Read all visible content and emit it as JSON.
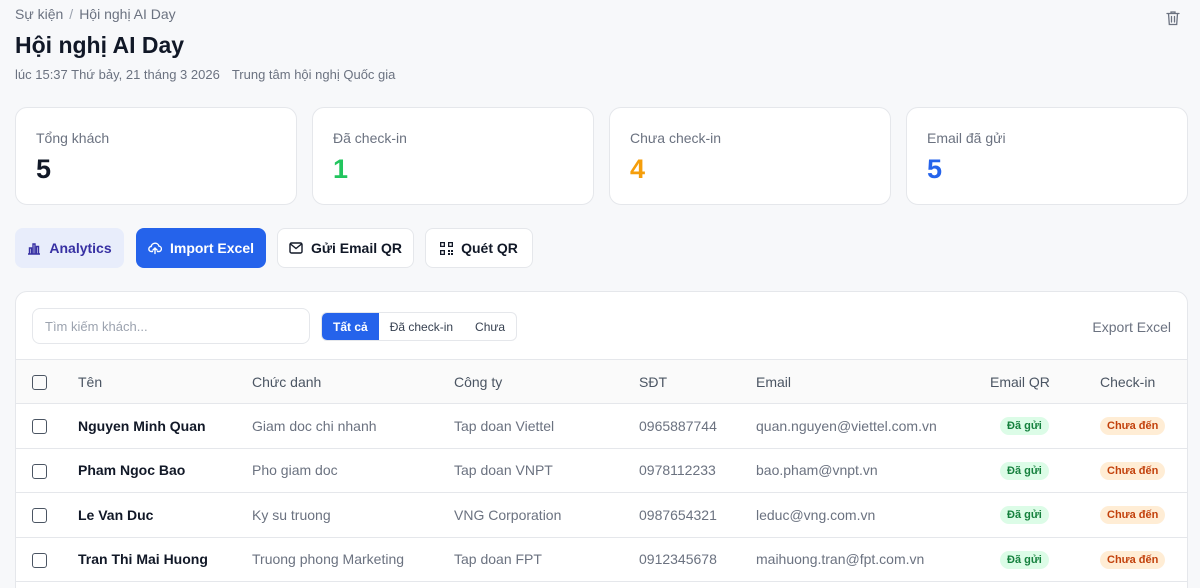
{
  "breadcrumb": {
    "parent": "Sự kiện",
    "separator": "/",
    "current": "Hội nghị AI Day"
  },
  "event": {
    "title": "Hội nghị AI Day",
    "datetime": "lúc 15:37 Thứ bảy, 21 tháng 3 2026",
    "venue": "Trung tâm hội nghị Quốc gia"
  },
  "stats": [
    {
      "label": "Tổng khách",
      "value": "5",
      "color": "#111827"
    },
    {
      "label": "Đã check-in",
      "value": "1",
      "color": "#22c55e"
    },
    {
      "label": "Chưa check-in",
      "value": "4",
      "color": "#f59e0b"
    },
    {
      "label": "Email đã gửi",
      "value": "5",
      "color": "#2563eb"
    }
  ],
  "actions": {
    "analytics": "Analytics",
    "import": "Import Excel",
    "email": "Gửi Email QR",
    "scan": "Quét QR"
  },
  "guests": {
    "search_placeholder": "Tìm kiếm khách...",
    "filters": [
      "Tất cả",
      "Đã check-in",
      "Chưa"
    ],
    "active_filter": 0,
    "export_label": "Export Excel",
    "columns": [
      "Tên",
      "Chức danh",
      "Công ty",
      "SĐT",
      "Email",
      "Email QR",
      "Check-in"
    ],
    "rows": [
      {
        "name": "Nguyen Minh Quan",
        "title": "Giam doc chi nhanh",
        "company": "Tap doan Viettel",
        "phone": "0965887744",
        "email": "quan.nguyen@viettel.com.vn",
        "email_qr": "Đã gửi",
        "checkin": "Chưa đến"
      },
      {
        "name": "Pham Ngoc Bao",
        "title": "Pho giam doc",
        "company": "Tap doan VNPT",
        "phone": "0978112233",
        "email": "bao.pham@vnpt.vn",
        "email_qr": "Đã gửi",
        "checkin": "Chưa đến"
      },
      {
        "name": "Le Van Duc",
        "title": "Ky su truong",
        "company": "VNG Corporation",
        "phone": "0987654321",
        "email": "leduc@vng.com.vn",
        "email_qr": "Đã gửi",
        "checkin": "Chưa đến"
      },
      {
        "name": "Tran Thi Mai Huong",
        "title": "Truong phong Marketing",
        "company": "Tap doan FPT",
        "phone": "0912345678",
        "email": "maihuong.tran@fpt.com.vn",
        "email_qr": "Đã gửi",
        "checkin": "Chưa đến"
      }
    ]
  }
}
